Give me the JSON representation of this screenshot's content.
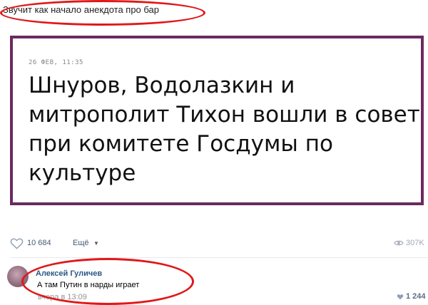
{
  "caption": "Звучит как начало анекдота про бар",
  "news": {
    "date": "26 ФЕВ, 11:35",
    "headline": "Шнуров, Водолазкин и митрополит Тихон вошли в совет при комитете Госдумы по культуре"
  },
  "actions": {
    "likes": "10 684",
    "more_label": "Ещё",
    "views": "307K"
  },
  "comment": {
    "author": "Алексей Гуличев",
    "text": "А там Путин в нарды играет",
    "time": "вчера в 13:09",
    "likes": "1 244"
  },
  "colors": {
    "highlight_oval": "#e01818",
    "card_border": "#6b2a5f",
    "link": "#2a5885"
  },
  "icons": [
    "heart-icon",
    "chevron-down-icon",
    "eye-icon",
    "avatar",
    "heart-icon"
  ]
}
